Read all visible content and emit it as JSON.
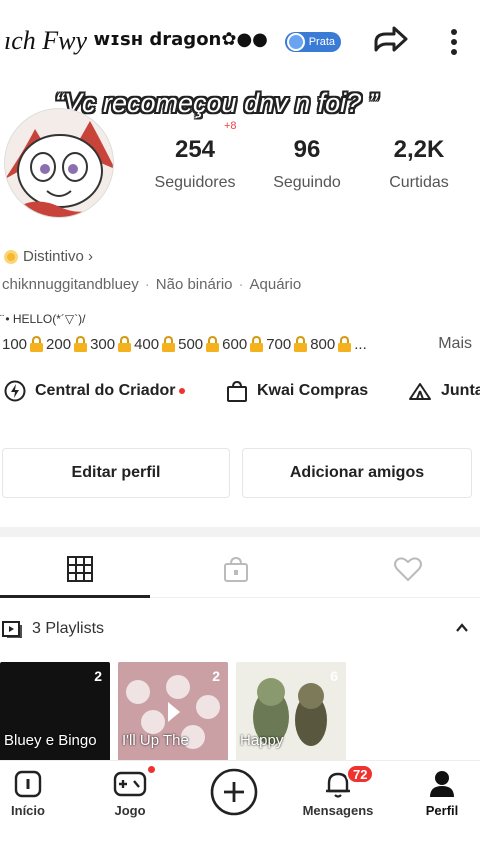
{
  "header": {
    "name": "ıch Fwy",
    "name_suffix": "ᴡɪsʜ dragon✿●●",
    "badge_label": "Prata"
  },
  "quote": "“Vc recomeçou dnv n foi? ”",
  "quote_badge": "+8",
  "stats": [
    {
      "value": "254",
      "label": "Seguidores"
    },
    {
      "value": "96",
      "label": "Seguindo"
    },
    {
      "value": "2,2K",
      "label": "Curtidas"
    }
  ],
  "profile": {
    "distintivo": "Distintivo ›",
    "handle": "chiknnuggitandbluey",
    "gender": "Não binário",
    "sign": "Aquário"
  },
  "bio": {
    "line1": "̈ • HELLO(*´▽`)/",
    "levels": [
      "100",
      "200",
      "300",
      "400",
      "500",
      "600",
      "700",
      "800"
    ],
    "ellipsis": "...",
    "more": "Mais"
  },
  "links": {
    "creator": "Central do Criador",
    "shop": "Kwai Compras",
    "join": "Junta"
  },
  "buttons": {
    "edit": "Editar perfil",
    "add": "Adicionar amigos"
  },
  "playlists": {
    "title": "3 Playlists",
    "items": [
      {
        "caption": "Bluey e Bingo",
        "count": "2"
      },
      {
        "caption": "I'll Up The",
        "count": "2"
      },
      {
        "caption": "Happy",
        "count": "6"
      }
    ]
  },
  "nav": {
    "home": "Início",
    "game": "Jogo",
    "messages": "Mensagens",
    "messages_count": "72",
    "profile": "Perfil"
  },
  "colors": {
    "accent_red": "#f0322f",
    "badge_blue": "#3a7bd5",
    "coin_gold": "#f7b731"
  }
}
